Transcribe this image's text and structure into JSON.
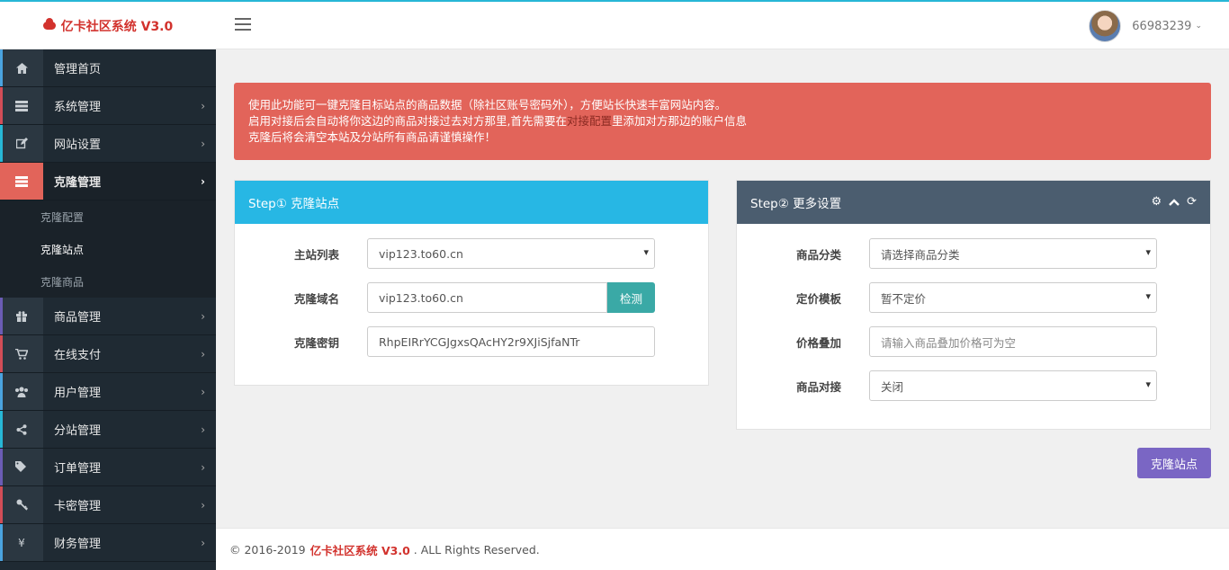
{
  "app": {
    "brand": "亿卡社区系统 V3.0",
    "username": "66983239"
  },
  "sidebar": {
    "items": [
      {
        "label": "管理首页",
        "icon": "home-icon",
        "accent": "#4aa3df",
        "has_chevron": false
      },
      {
        "label": "系统管理",
        "icon": "server-icon",
        "accent": "#d24d57",
        "has_chevron": true
      },
      {
        "label": "网站设置",
        "icon": "edit-icon",
        "accent": "#27b7d6",
        "has_chevron": true
      },
      {
        "label": "克隆管理",
        "icon": "server-icon",
        "accent": "#e2645a",
        "has_chevron": true,
        "active": true
      },
      {
        "label": "商品管理",
        "icon": "gift-icon",
        "accent": "#6b5cb5",
        "has_chevron": true
      },
      {
        "label": "在线支付",
        "icon": "cart-icon",
        "accent": "#d24d57",
        "has_chevron": true
      },
      {
        "label": "用户管理",
        "icon": "users-icon",
        "accent": "#4aa3df",
        "has_chevron": true
      },
      {
        "label": "分站管理",
        "icon": "share-icon",
        "accent": "#27b7d6",
        "has_chevron": true
      },
      {
        "label": "订单管理",
        "icon": "tags-icon",
        "accent": "#6b5cb5",
        "has_chevron": true
      },
      {
        "label": "卡密管理",
        "icon": "key-icon",
        "accent": "#d24d57",
        "has_chevron": true
      },
      {
        "label": "财务管理",
        "icon": "money-icon",
        "accent": "#4aa3df",
        "has_chevron": true
      }
    ],
    "subitems": [
      {
        "label": "克隆配置"
      },
      {
        "label": "克隆站点",
        "current": true
      },
      {
        "label": "克隆商品"
      }
    ]
  },
  "alert": {
    "line1": "使用此功能可一键克隆目标站点的商品数据（除社区账号密码外），方便站长快速丰富网站内容。",
    "line2_pre": "启用对接后会自动将你这边的商品对接过去对方那里,首先需要在",
    "line2_link": "对接配置",
    "line2_post": "里添加对方那边的账户信息",
    "line3": "克隆后将会清空本站及分站所有商品请谨慎操作！"
  },
  "step1": {
    "title": "Step① 克隆站点",
    "main_site_label": "主站列表",
    "main_site_value": "vip123.to60.cn",
    "domain_label": "克隆域名",
    "domain_value": "vip123.to60.cn",
    "check_button": "检测",
    "key_label": "克隆密钥",
    "key_value": "RhpEIRrYCGJgxsQAcHY2r9XJiSjfaNTr"
  },
  "step2": {
    "title": "Step② 更多设置",
    "category_label": "商品分类",
    "category_value": "请选择商品分类",
    "pricing_label": "定价模板",
    "pricing_value": "暂不定价",
    "markup_label": "价格叠加",
    "markup_placeholder": "请输入商品叠加价格可为空",
    "dock_label": "商品对接",
    "dock_value": "关闭"
  },
  "actions": {
    "clone_button": "克隆站点"
  },
  "footer": {
    "copyright": "© 2016-2019",
    "brand": "亿卡社区系统 V3.0",
    "rights": ". ALL Rights Reserved."
  }
}
